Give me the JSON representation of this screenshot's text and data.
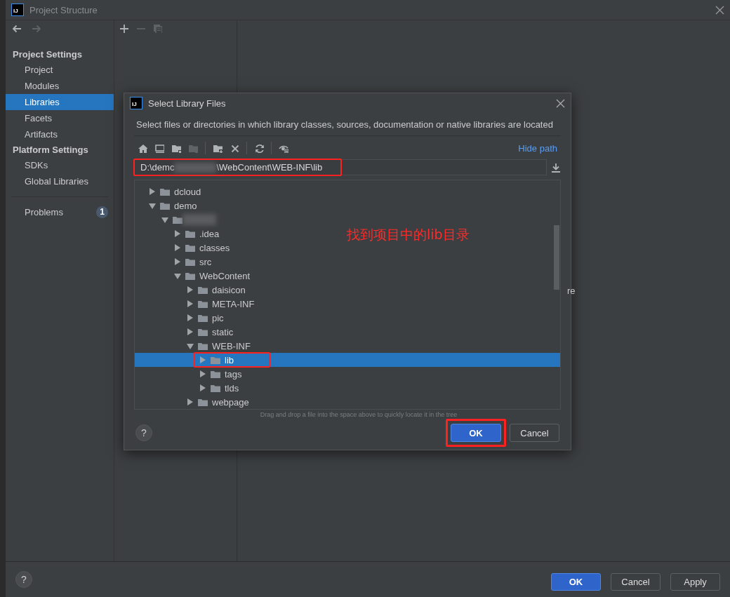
{
  "window": {
    "logo": "IJ",
    "title": "Project Structure"
  },
  "nav": {
    "back": {
      "disabled": false
    },
    "forward": {
      "disabled": true
    }
  },
  "sidebar": {
    "sections": [
      {
        "heading": "Project Settings",
        "items": [
          {
            "label": "Project",
            "selected": false
          },
          {
            "label": "Modules",
            "selected": false
          },
          {
            "label": "Libraries",
            "selected": true
          },
          {
            "label": "Facets",
            "selected": false
          },
          {
            "label": "Artifacts",
            "selected": false
          }
        ]
      },
      {
        "heading": "Platform Settings",
        "items": [
          {
            "label": "SDKs",
            "selected": false
          },
          {
            "label": "Global Libraries",
            "selected": false
          }
        ]
      }
    ],
    "problems": {
      "label": "Problems",
      "count": "1"
    }
  },
  "middle_toolbar": [
    {
      "kind": "add",
      "disabled": false
    },
    {
      "kind": "remove",
      "disabled": true
    },
    {
      "kind": "copy",
      "disabled": true
    }
  ],
  "right_panel": {
    "text": "re"
  },
  "dialog": {
    "logo": "IJ",
    "title": "Select Library Files",
    "description": "Select files or directories in which library classes, sources, documentation or native libraries are located",
    "toolbar": [
      {
        "kind": "home",
        "disabled": false
      },
      {
        "kind": "desktop",
        "disabled": false
      },
      {
        "kind": "project",
        "disabled": false
      },
      {
        "kind": "module",
        "disabled": true
      },
      {
        "kind": "separator"
      },
      {
        "kind": "new-folder",
        "disabled": false
      },
      {
        "kind": "delete",
        "disabled": false
      },
      {
        "kind": "separator"
      },
      {
        "kind": "refresh",
        "disabled": false
      },
      {
        "kind": "separator"
      },
      {
        "kind": "show-hidden",
        "disabled": false
      }
    ],
    "hide_path": "Hide path",
    "path_field": {
      "value_start": "D:\\demc",
      "value_end": "\\WebContent\\WEB-INF\\lib",
      "highlighted": true
    },
    "tree": [
      {
        "label": "dcloud",
        "expanded": false,
        "selected": false,
        "highlighted": false
      },
      {
        "label": "demo",
        "expanded": true,
        "selected": false,
        "highlighted": false,
        "children": [
          {
            "redacted": true,
            "expanded": true,
            "selected": false,
            "highlighted": false,
            "children": [
              {
                "label": ".idea",
                "expanded": false,
                "selected": false,
                "highlighted": false
              },
              {
                "label": "classes",
                "expanded": false,
                "selected": false,
                "highlighted": false
              },
              {
                "label": "src",
                "expanded": false,
                "selected": false,
                "highlighted": false
              },
              {
                "label": "WebContent",
                "expanded": true,
                "selected": false,
                "highlighted": false,
                "children": [
                  {
                    "label": "daisicon",
                    "expanded": false,
                    "selected": false,
                    "highlighted": false
                  },
                  {
                    "label": "META-INF",
                    "expanded": false,
                    "selected": false,
                    "highlighted": false
                  },
                  {
                    "label": "pic",
                    "expanded": false,
                    "selected": false,
                    "highlighted": false
                  },
                  {
                    "label": "static",
                    "expanded": false,
                    "selected": false,
                    "highlighted": false
                  },
                  {
                    "label": "WEB-INF",
                    "expanded": true,
                    "selected": false,
                    "highlighted": false,
                    "children": [
                      {
                        "label": "lib",
                        "expanded": false,
                        "selected": true,
                        "highlighted": true
                      },
                      {
                        "label": "tags",
                        "expanded": false,
                        "selected": false,
                        "highlighted": false
                      },
                      {
                        "label": "tlds",
                        "expanded": false,
                        "selected": false,
                        "highlighted": false
                      }
                    ]
                  },
                  {
                    "label": "webpage",
                    "expanded": false,
                    "selected": false,
                    "highlighted": false
                  }
                ]
              }
            ]
          }
        ]
      }
    ],
    "annotation": "找到项目中的lib目录",
    "hint": "Drag and drop a file into the space above to quickly locate it in the tree",
    "help": "?",
    "buttons": [
      {
        "label": "OK",
        "primary": true,
        "highlighted": true
      },
      {
        "label": "Cancel",
        "primary": false,
        "highlighted": false
      }
    ]
  },
  "footer": {
    "help": "?",
    "buttons": [
      {
        "label": "OK",
        "primary": true
      },
      {
        "label": "Cancel",
        "primary": false
      },
      {
        "label": "Apply",
        "primary": false
      }
    ]
  }
}
